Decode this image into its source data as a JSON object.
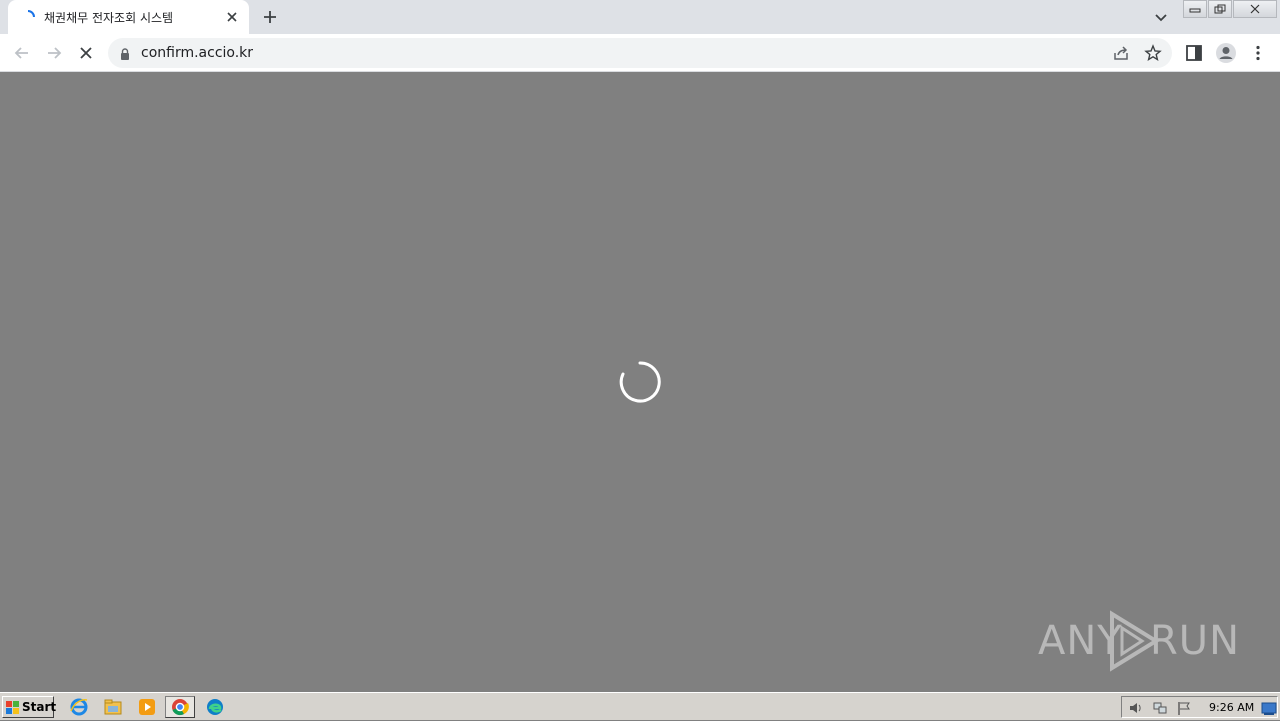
{
  "browser": {
    "tab": {
      "title": "채권채무 전자조회 시스템"
    },
    "omnibox": {
      "url": "confirm.accio.kr"
    }
  },
  "watermark": {
    "left": "ANY",
    "right": "RUN"
  },
  "taskbar": {
    "start_label": "Start",
    "clock": "9:26 AM",
    "pinned": [
      "internet-explorer-icon",
      "file-explorer-icon",
      "media-player-icon",
      "chrome-icon",
      "edge-icon"
    ]
  },
  "colors": {
    "tabstrip": "#dee1e6",
    "toolbar": "#ffffff",
    "omnibox": "#f1f3f4",
    "content": "#808080",
    "spinner": "#ffffff",
    "taskbar": "#d6d3ce"
  }
}
